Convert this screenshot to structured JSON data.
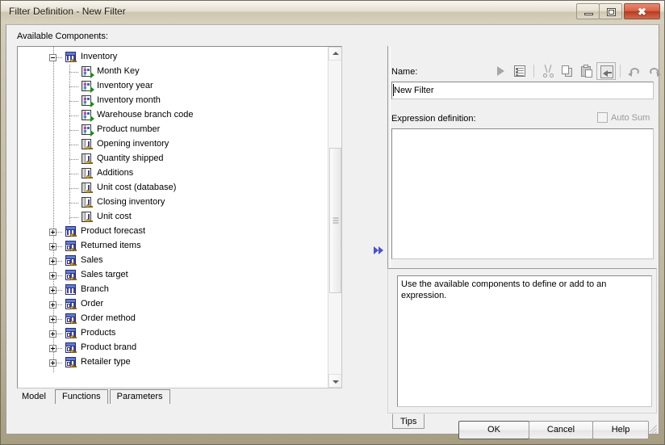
{
  "window": {
    "title": "Filter Definition - New Filter",
    "controls": {
      "minimize": "minimize-button",
      "maximize": "maximize-button",
      "close": "✖"
    }
  },
  "left_panel": {
    "label": "Available Components:",
    "tree": [
      {
        "label": "Inventory",
        "depth": 0,
        "icon": "fact-table-icon",
        "expander": "minus"
      },
      {
        "label": "Month Key",
        "depth": 1,
        "icon": "query-item-icon",
        "expander": "none"
      },
      {
        "label": "Inventory year",
        "depth": 1,
        "icon": "query-item-icon",
        "expander": "none"
      },
      {
        "label": "Inventory month",
        "depth": 1,
        "icon": "query-item-icon",
        "expander": "none"
      },
      {
        "label": "Warehouse branch code",
        "depth": 1,
        "icon": "query-item-icon",
        "expander": "none"
      },
      {
        "label": "Product number",
        "depth": 1,
        "icon": "query-item-icon",
        "expander": "none"
      },
      {
        "label": "Opening inventory",
        "depth": 1,
        "icon": "measure-icon",
        "expander": "none"
      },
      {
        "label": "Quantity shipped",
        "depth": 1,
        "icon": "measure-icon",
        "expander": "none"
      },
      {
        "label": "Additions",
        "depth": 1,
        "icon": "measure-icon",
        "expander": "none"
      },
      {
        "label": "Unit cost (database)",
        "depth": 1,
        "icon": "measure-icon",
        "expander": "none"
      },
      {
        "label": "Closing inventory",
        "depth": 1,
        "icon": "measure-icon",
        "expander": "none"
      },
      {
        "label": "Unit cost",
        "depth": 1,
        "icon": "measure-icon",
        "expander": "none"
      },
      {
        "label": "Product forecast",
        "depth": 0,
        "icon": "fact-table-icon",
        "expander": "plus"
      },
      {
        "label": "Returned items",
        "depth": 0,
        "icon": "dim-table-icon",
        "expander": "plus"
      },
      {
        "label": "Sales",
        "depth": 0,
        "icon": "dim-table-icon",
        "expander": "plus"
      },
      {
        "label": "Sales target",
        "depth": 0,
        "icon": "dim-table-icon",
        "expander": "plus"
      },
      {
        "label": "Branch",
        "depth": 0,
        "icon": "plain-table-icon",
        "expander": "plus"
      },
      {
        "label": "Order",
        "depth": 0,
        "icon": "dim-table-icon",
        "expander": "plus"
      },
      {
        "label": "Order method",
        "depth": 0,
        "icon": "dim-table-icon",
        "expander": "plus"
      },
      {
        "label": "Products",
        "depth": 0,
        "icon": "dim-table-icon",
        "expander": "plus"
      },
      {
        "label": "Product brand",
        "depth": 0,
        "icon": "dim-table-icon",
        "expander": "plus"
      },
      {
        "label": "Retailer type",
        "depth": 0,
        "icon": "dim-table-icon",
        "expander": "plus"
      }
    ],
    "tabs": [
      {
        "label": "Model",
        "active": true
      },
      {
        "label": "Functions",
        "active": false
      },
      {
        "label": "Parameters",
        "active": false
      }
    ]
  },
  "transfer": {
    "arrow": "add-to-expression-arrow"
  },
  "right_panel": {
    "name_label": "Name:",
    "name_value": "New Filter",
    "expression_label": "Expression definition:",
    "expression_value": "",
    "auto_sum_label": "Auto Sum",
    "auto_sum_checked": false,
    "toolbar": [
      {
        "name": "run-button",
        "icon": "play-icon",
        "enabled": false
      },
      {
        "name": "validate-button",
        "icon": "list-icon",
        "enabled": false
      },
      {
        "name": "cut-button",
        "icon": "scissors-icon",
        "enabled": false
      },
      {
        "name": "copy-button",
        "icon": "copy-icon",
        "enabled": false
      },
      {
        "name": "paste-button",
        "icon": "paste-icon",
        "enabled": false
      },
      {
        "name": "paste-special-button",
        "icon": "paste-special-icon",
        "enabled": false
      },
      {
        "name": "undo-button",
        "icon": "undo-icon",
        "enabled": false
      },
      {
        "name": "redo-button",
        "icon": "redo-icon",
        "enabled": false
      }
    ],
    "tips_tab_label": "Tips",
    "tips_text": "Use the available components to define or add to an expression."
  },
  "footer": {
    "ok": "OK",
    "cancel": "Cancel",
    "help": "Help"
  },
  "colors": {
    "title_bar": "#ded8c8",
    "dialog_bg": "#f0f0f0",
    "close_button": "#c0442a",
    "arrow_blue": "#2b35c8",
    "accent_icon_blue": "#3f3fa8",
    "key_yellow": "#f5c518"
  }
}
